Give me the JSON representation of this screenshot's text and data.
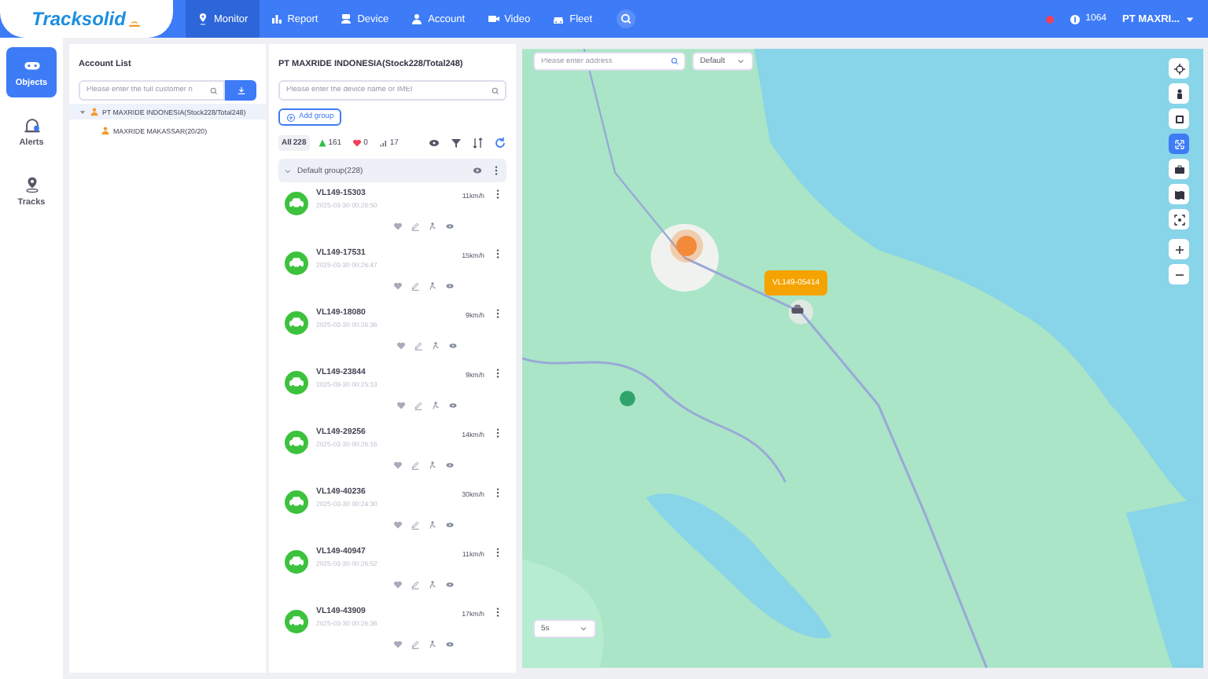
{
  "logo": {
    "text": "Tracksolid"
  },
  "nav": [
    {
      "label": "Monitor",
      "selected": true
    },
    {
      "label": "Report",
      "selected": false
    },
    {
      "label": "Device",
      "selected": false
    },
    {
      "label": "Account",
      "selected": false
    },
    {
      "label": "Video",
      "selected": false
    },
    {
      "label": "Fleet",
      "selected": false
    }
  ],
  "header_right": {
    "notification": true,
    "points": "1064",
    "user": "PT MAXRI..."
  },
  "rail": [
    {
      "label": "Objects",
      "selected": true
    },
    {
      "label": "Alerts",
      "selected": false
    },
    {
      "label": "Tracks",
      "selected": false
    }
  ],
  "account_list": {
    "title": "Account List",
    "search": {
      "placeholder": "Please enter the full customer n"
    },
    "tree": [
      {
        "label": "PT MAXRIDE INDONESIA(Stock228/Total248)",
        "expanded": true,
        "selected": true,
        "children": [
          {
            "label": "MAXRIDE MAKASSAR(20/20)",
            "selected": false
          }
        ]
      }
    ]
  },
  "devices": {
    "title": "PT MAXRIDE INDONESIA(Stock228/Total248)",
    "search": {
      "placeholder": "Please enter the device name or IMEI"
    },
    "add_group": "Add group",
    "filters": [
      {
        "kind": "all",
        "label": "All",
        "count": "228",
        "selected": true
      },
      {
        "kind": "online",
        "count": "161",
        "selected": false
      },
      {
        "kind": "alarm",
        "count": "0",
        "selected": false
      },
      {
        "kind": "offline",
        "count": "17",
        "selected": false
      }
    ],
    "group": {
      "label": "Default group(228)",
      "expanded": true
    },
    "items": [
      {
        "name": "VL149-15303",
        "time": "2025-03-30 00:26:50",
        "speed": "11km/h"
      },
      {
        "name": "VL149-17531",
        "time": "2025-03-30 00:26:47",
        "speed": "15km/h"
      },
      {
        "name": "VL149-18080",
        "time": "2025-03-30 00:26:36",
        "speed": "9km/h"
      },
      {
        "name": "VL149-23844",
        "time": "2025-03-30 00:25:13",
        "speed": "9km/h"
      },
      {
        "name": "VL149-29256",
        "time": "2025-03-30 00:26:16",
        "speed": "14km/h"
      },
      {
        "name": "VL149-40236",
        "time": "2025-03-30 00:24:30",
        "speed": "30km/h"
      },
      {
        "name": "VL149-40947",
        "time": "2025-03-30 00:26:52",
        "speed": "11km/h"
      },
      {
        "name": "VL149-43909",
        "time": "2025-03-30 00:26:36",
        "speed": "17km/h"
      }
    ]
  },
  "map": {
    "search": {
      "placeholder": "Please enter address"
    },
    "layer_select": "Default",
    "refresh_select": "5s",
    "vehicle_label": "VL149-05414",
    "tools": [
      {
        "selected": false
      },
      {
        "selected": false
      },
      {
        "selected": false
      },
      {
        "selected": true
      },
      {
        "selected": false
      },
      {
        "selected": false
      },
      {
        "selected": false
      },
      {
        "selected": false
      },
      {
        "selected": false
      }
    ]
  }
}
